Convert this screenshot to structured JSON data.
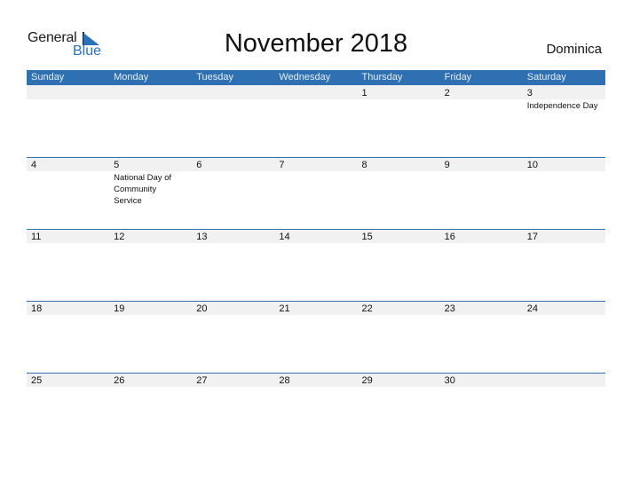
{
  "logo": {
    "word1": "General",
    "word2": "Blue"
  },
  "header": {
    "title": "November 2018",
    "country": "Dominica"
  },
  "colors": {
    "accent": "#2e70b1",
    "band": "#f1f1f1"
  },
  "days": [
    "Sunday",
    "Monday",
    "Tuesday",
    "Wednesday",
    "Thursday",
    "Friday",
    "Saturday"
  ],
  "weeks": [
    [
      {
        "d": ""
      },
      {
        "d": ""
      },
      {
        "d": ""
      },
      {
        "d": ""
      },
      {
        "d": "1"
      },
      {
        "d": "2"
      },
      {
        "d": "3",
        "h": "Independence Day"
      }
    ],
    [
      {
        "d": "4"
      },
      {
        "d": "5",
        "h": "National Day of Community Service"
      },
      {
        "d": "6"
      },
      {
        "d": "7"
      },
      {
        "d": "8"
      },
      {
        "d": "9"
      },
      {
        "d": "10"
      }
    ],
    [
      {
        "d": "11"
      },
      {
        "d": "12"
      },
      {
        "d": "13"
      },
      {
        "d": "14"
      },
      {
        "d": "15"
      },
      {
        "d": "16"
      },
      {
        "d": "17"
      }
    ],
    [
      {
        "d": "18"
      },
      {
        "d": "19"
      },
      {
        "d": "20"
      },
      {
        "d": "21"
      },
      {
        "d": "22"
      },
      {
        "d": "23"
      },
      {
        "d": "24"
      }
    ],
    [
      {
        "d": "25"
      },
      {
        "d": "26"
      },
      {
        "d": "27"
      },
      {
        "d": "28"
      },
      {
        "d": "29"
      },
      {
        "d": "30"
      },
      {
        "d": ""
      }
    ]
  ]
}
